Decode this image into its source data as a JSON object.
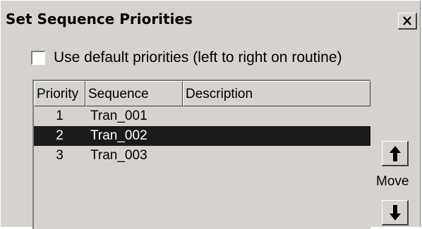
{
  "dialog": {
    "title": "Set Sequence Priorities",
    "close_icon": "close-icon"
  },
  "options": {
    "use_default_label": "Use default priorities (left to right on routine)",
    "use_default_checked": false
  },
  "list": {
    "columns": [
      "Priority",
      "Sequence",
      "Description"
    ],
    "rows": [
      {
        "priority": "1",
        "sequence": "Tran_001",
        "description": ""
      },
      {
        "priority": "2",
        "sequence": "Tran_002",
        "description": ""
      },
      {
        "priority": "3",
        "sequence": "Tran_003",
        "description": ""
      }
    ],
    "selected_index": 1
  },
  "move": {
    "label": "Move",
    "up_icon": "arrow-up-icon",
    "down_icon": "arrow-down-icon"
  },
  "colors": {
    "face": "#d6d3ce",
    "selection": "#1b1b1b"
  }
}
